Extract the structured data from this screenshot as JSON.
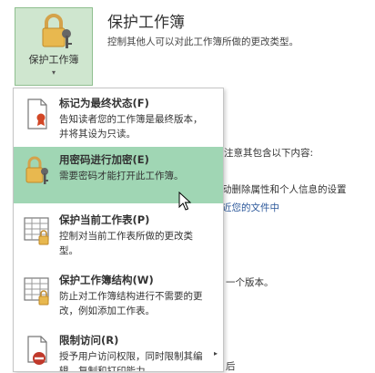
{
  "protect_button": {
    "label": "保护工作簿",
    "caret": "▾",
    "icon": "lock-key-icon"
  },
  "section": {
    "title": "保护工作簿",
    "description": "控制其他人可以对此工作簿所做的更改类型。"
  },
  "background_texts": {
    "line1": "注意其包含以下内容:",
    "line2": "动删除属性和个人信息的设置",
    "line3": "近您的文件中",
    "line4": "一个版本。",
    "line5": "后"
  },
  "menu": {
    "items": [
      {
        "title": "标记为最终状态(F)",
        "desc": "告知读者您的工作簿是最终版本，并将其设为只读。",
        "icon": "final-document-icon",
        "has_submenu": false
      },
      {
        "title": "用密码进行加密(E)",
        "desc": "需要密码才能打开此工作簿。",
        "icon": "lock-key-icon",
        "has_submenu": false
      },
      {
        "title": "保护当前工作表(P)",
        "desc": "控制对当前工作表所做的更改类型。",
        "icon": "protect-sheet-icon",
        "has_submenu": false
      },
      {
        "title": "保护工作簿结构(W)",
        "desc": "防止对工作簿结构进行不需要的更改，例如添加工作表。",
        "icon": "protect-structure-icon",
        "has_submenu": false
      },
      {
        "title": "限制访问(R)",
        "desc": "授予用户访问权限，同时限制其编辑、复制和打印能力。",
        "icon": "restrict-access-icon",
        "has_submenu": true,
        "arrow": "▸"
      }
    ]
  },
  "colors": {
    "button_bg": "#cfe6cf",
    "highlight": "#a0d6b4",
    "link": "#2b579a"
  }
}
